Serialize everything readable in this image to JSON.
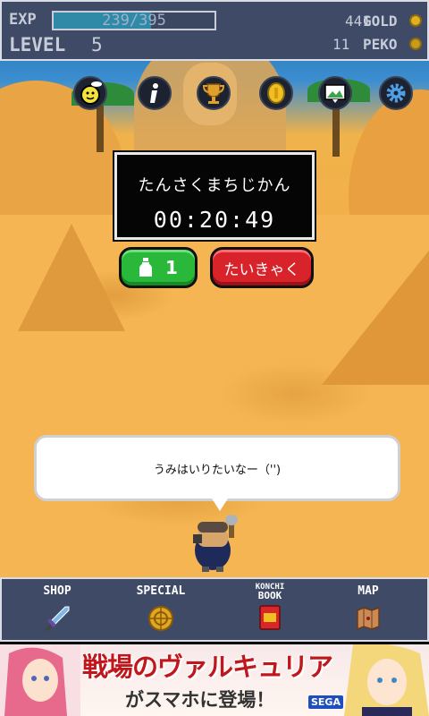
{
  "status": {
    "exp_label": "EXP",
    "exp_text": "239/395",
    "exp_fraction": 0.605,
    "level_label": "LEVEL",
    "level_value": "5",
    "gold_value": "441",
    "gold_label": "GOLD",
    "peko_value": "11",
    "peko_label": "PEKO"
  },
  "toolbar": {
    "icons": [
      "mascot-icon",
      "info-icon",
      "trophy-icon",
      "coin-icon",
      "image-icon",
      "gear-icon"
    ]
  },
  "timer": {
    "label": "たんさくまちじかん",
    "time": "00:20:49"
  },
  "actions": {
    "item_count": "1",
    "retreat_label": "たいきゃく"
  },
  "dialog": {
    "text": "うみはいりたいなー（'')"
  },
  "nav": {
    "shop": "SHOP",
    "special": "SPECIAL",
    "konchi_line1": "KONCHI",
    "konchi_line2": "BOOK",
    "map": "MAP"
  },
  "ad": {
    "title": "戦場のヴァルキュリア",
    "subtitle": "がスマホに登場！",
    "brand": "SEGA"
  },
  "colors": {
    "accent_green": "#29b83a",
    "accent_red": "#d8232a",
    "bar_bg": "#3e4a66"
  }
}
